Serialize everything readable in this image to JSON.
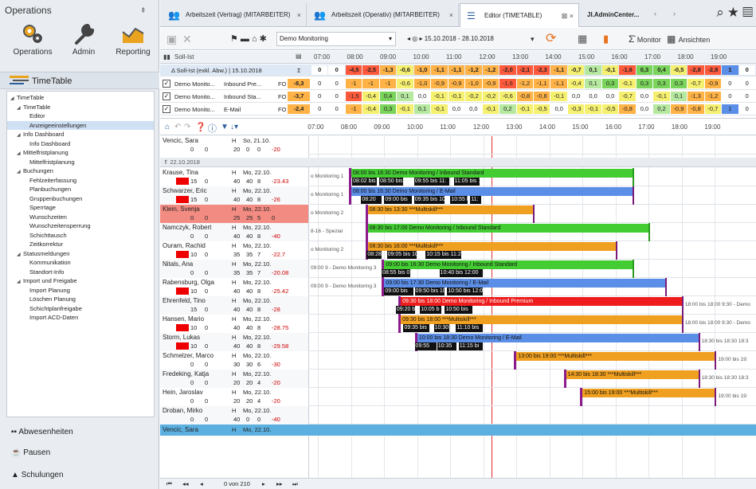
{
  "left": {
    "title": "Operations",
    "pin": "⇞",
    "ribbon": [
      {
        "label": "Operations",
        "icon": "gears-icon"
      },
      {
        "label": "Admin",
        "icon": "wrench-icon"
      },
      {
        "label": "Reporting",
        "icon": "chart-icon"
      }
    ],
    "section_title": "TimeTable",
    "tree": [
      {
        "label": "TimeTable",
        "level": 0,
        "toggle": "◢"
      },
      {
        "label": "TimeTable",
        "level": 1,
        "toggle": "◢"
      },
      {
        "label": "Editor",
        "level": 2
      },
      {
        "label": "Anzeigeeinstellungen",
        "level": 2,
        "selected": true
      },
      {
        "label": "Info Dashboard",
        "level": 1,
        "toggle": "◢"
      },
      {
        "label": "Info Dashboard",
        "level": 2
      },
      {
        "label": "Mittelfristplanung",
        "level": 1,
        "toggle": "◢"
      },
      {
        "label": "Mittelfristplanung",
        "level": 2
      },
      {
        "label": "Buchungen",
        "level": 1,
        "toggle": "◢"
      },
      {
        "label": "Fehlzeiterfassung",
        "level": 2
      },
      {
        "label": "Planbuchungen",
        "level": 2
      },
      {
        "label": "Gruppenbuchungen",
        "level": 2
      },
      {
        "label": "Sperrtage",
        "level": 2
      },
      {
        "label": "Wunschzeiten",
        "level": 2
      },
      {
        "label": "Wunschzeitensperrung",
        "level": 2
      },
      {
        "label": "Schichttausch",
        "level": 2
      },
      {
        "label": "Zeitkorrektur",
        "level": 2
      },
      {
        "label": "Statusmeldungen",
        "level": 1,
        "toggle": "◢"
      },
      {
        "label": "Kommunikation",
        "level": 2
      },
      {
        "label": "Standort-Info",
        "level": 2
      },
      {
        "label": "Import und Freigabe",
        "level": 1,
        "toggle": "◢"
      },
      {
        "label": "Import Planung",
        "level": 2
      },
      {
        "label": "Löschen Planung",
        "level": 2
      },
      {
        "label": "Schichtplanfreigabe",
        "level": 2
      },
      {
        "label": "Import ACD-Daten",
        "level": 2
      }
    ],
    "bottom": [
      {
        "label": "Abwesenheiten",
        "icon": "people-icon"
      },
      {
        "label": "Pausen",
        "icon": "cup-icon"
      },
      {
        "label": "Schulungen",
        "icon": "graduation-cap-icon"
      }
    ]
  },
  "tabs": [
    {
      "label": "Arbeitszeit (Vertrag) (MITARBEITER)",
      "close": "×"
    },
    {
      "label": "Arbeitszeit (Operativ) (MITARBEITER)",
      "close": "×"
    },
    {
      "label": "Editor (TIMETABLE)",
      "close": "⊠ ×",
      "active": true
    },
    {
      "label": "JI.AdminCenter...",
      "close": ""
    }
  ],
  "toolbar": {
    "scenario": "Demo Monitoring",
    "date_range": "15.10.2018 - 28.10.2018",
    "monitor_label": "Monitor",
    "views_label": "Ansichten"
  },
  "soll_ist": {
    "header_label": "Soll-Ist",
    "times": [
      "07:00",
      "08:00",
      "09:00",
      "10:00",
      "11:00",
      "12:00",
      "13:00",
      "14:00",
      "15:00",
      "16:00",
      "17:00",
      "18:00",
      "19:00"
    ],
    "summary_label": "Δ Soll-Ist (exkl. Abw.) | 15.10.2018",
    "summary_sum": "Σ",
    "summary_vals": [
      "0",
      "0",
      "-4,5",
      "-2,5",
      "-1,3",
      "-0,6",
      "-1,0",
      "-1,1",
      "-1,1",
      "-1,2",
      "-1,2",
      "-2,0",
      "-2,1",
      "-2,3",
      "-1,1",
      "-0,7",
      "0,1",
      "-0,1",
      "-1,6",
      "0,3",
      "0,4",
      "-0,5",
      "-2,8",
      "-2,8",
      "1",
      "0"
    ],
    "rows": [
      {
        "a": "Demo Monito...",
        "b": "Inbound Pre...",
        "c": "FO",
        "sum": "-8,3",
        "vals": [
          "0",
          "0",
          "-1",
          "-1",
          "-1",
          "-0,6",
          "-1,0",
          "-0,9",
          "-0,9",
          "-1,0",
          "-0,9",
          "-1,6",
          "-1,2",
          "-1,1",
          "-1,1",
          "-0,4",
          "0,1",
          "0,3",
          "-0,1",
          "0,3",
          "0,3",
          "0,3",
          "-0,7",
          "-0,9",
          "0",
          "0"
        ]
      },
      {
        "a": "Demo Monito...",
        "b": "Inbound Sta...",
        "c": "FO",
        "sum": "-3,7",
        "vals": [
          "0",
          "0",
          "-1,5",
          "-0,4",
          "0,4",
          "0,1",
          "0,0",
          "-0,1",
          "-0,1",
          "-0,2",
          "-0,2",
          "-0,6",
          "-0,8",
          "-0,8",
          "-0,1",
          "0,0",
          "0,0",
          "0,0",
          "-0,7",
          "0,0",
          "-0,1",
          "0,1",
          "-1,3",
          "-1,2",
          "0",
          "0"
        ]
      },
      {
        "a": "Demo Monito...",
        "b": "E-Mail",
        "c": "FO",
        "sum": "-2,4",
        "vals": [
          "0",
          "0",
          "-1",
          "-0,4",
          "0,3",
          "-0,1",
          "0,1",
          "-0,1",
          "0,0",
          "0,0",
          "-0,1",
          "0,2",
          "-0,1",
          "-0,5",
          "0,0",
          "-0,3",
          "-0,1",
          "-0,5",
          "-0,8",
          "0,0",
          "0,2",
          "-0,9",
          "-0,8",
          "-0,7",
          "1",
          "0"
        ]
      }
    ]
  },
  "timeline": {
    "times": [
      "07:00",
      "08:00",
      "09:00",
      "10:00",
      "11:00",
      "12:00",
      "13:00",
      "14:00",
      "15:00",
      "16:00",
      "17:00",
      "18:00",
      "19:00"
    ],
    "date_header": "22.10.2018",
    "employees": [
      {
        "name": "Vencic, Sara",
        "type": "H",
        "day": "So, 21.10.",
        "v1": "0",
        "v2": "0",
        "v3": "20",
        "v4": "0",
        "v5": "0",
        "v6": "-20",
        "v6neg": true
      },
      {
        "name": "Krause, Tina",
        "type": "H",
        "day": "Mo, 22.10.",
        "v1": "15",
        "v2": "0",
        "v3": "40",
        "v4": "40",
        "v5": "8",
        "v6": "-23.43",
        "v6neg": true,
        "red": true,
        "sub": "o Monitoring 1",
        "bar": {
          "label": "08:00 bis 16:30 Demo Monitoring / Inbound Standard",
          "start": 8.0,
          "end": 16.5,
          "color": "#44cc33"
        },
        "blocks": [
          {
            "label": "08:02 bis 08:",
            "s": 8.03,
            "e": 8.8
          },
          {
            "label": "08:50 bis 09:",
            "s": 8.85,
            "e": 9.6
          },
          {
            "label": "09:55 bis 11:",
            "s": 9.9,
            "e": 11.0
          },
          {
            "label": "11:05 bis 1",
            "s": 11.1,
            "e": 11.9
          }
        ]
      },
      {
        "name": "Schwarzer, Eric",
        "type": "H",
        "day": "Mo, 22.10.",
        "v1": "15",
        "v2": "0",
        "v3": "40",
        "v4": "40",
        "v5": "8",
        "v6": "-26",
        "v6neg": true,
        "red": true,
        "sub": "o Monitoring 1",
        "bar": {
          "label": "08:00 bis 16:30 Demo Monitoring / E-Mail",
          "start": 8.0,
          "end": 16.5,
          "color": "#5b8ee6"
        },
        "blocks": [
          {
            "label": "08:20",
            "s": 8.3,
            "e": 8.95
          },
          {
            "label": "09:00 bis",
            "s": 9.0,
            "e": 9.85
          },
          {
            "label": "09:35 bis 10",
            "s": 9.9,
            "e": 10.85
          },
          {
            "label": "10:55 b",
            "s": 11.0,
            "e": 11.55
          },
          {
            "label": "11:",
            "s": 11.6,
            "e": 11.95
          }
        ]
      },
      {
        "name": "Klein, Svenja",
        "type": "H",
        "day": "Mo, 22.10.",
        "v1": "0",
        "v2": "0",
        "v3": "25",
        "v4": "25",
        "v5": "5",
        "v6": "0",
        "v6neg": false,
        "highlight": true,
        "sub": "o Monitoring 2",
        "bar": {
          "label": "08:30 bis 13:30 ***Multiskill***",
          "start": 8.5,
          "end": 13.5,
          "color": "#f0a020"
        },
        "blocks": []
      },
      {
        "name": "Namczyk, Robert",
        "type": "H",
        "day": "Mo, 22.10.",
        "v1": "0",
        "v2": "0",
        "v3": "40",
        "v4": "40",
        "v5": "8",
        "v6": "-40",
        "v6neg": true,
        "sub": "8-16 - Spezial",
        "bar": {
          "label": "08:30 bis 17:00 Demo Monitoring / Inbound Standard",
          "start": 8.5,
          "end": 17.0,
          "color": "#44cc33"
        },
        "blocks": []
      },
      {
        "name": "Ouram, Rachid",
        "type": "H",
        "day": "Mo, 22.10.",
        "v1": "10",
        "v2": "0",
        "v3": "35",
        "v4": "35",
        "v5": "7",
        "v6": "-22.7",
        "v6neg": true,
        "red": true,
        "sub": "o Monitoring 2",
        "bar": {
          "label": "08:30 bis 16:00 ***Multiskill***",
          "start": 8.5,
          "end": 16.0,
          "color": "#f0a020"
        },
        "blocks": [
          {
            "label": "08:28",
            "s": 8.47,
            "e": 8.95
          },
          {
            "label": "09:05 bis 10",
            "s": 9.08,
            "e": 10.0
          },
          {
            "label": "10:15 bis 11:2",
            "s": 10.25,
            "e": 11.35
          }
        ]
      },
      {
        "name": "Nitals, Ana",
        "type": "H",
        "day": "Mo, 22.10.",
        "v1": "0",
        "v2": "0",
        "v3": "35",
        "v4": "35",
        "v5": "7",
        "v6": "-20.08",
        "v6neg": true,
        "sub": "09:00 9 - Demo Monitoring 3",
        "bar": {
          "label": "09:00 bis 16:30 Demo Monitoring / Inbound Standard",
          "start": 9.0,
          "end": 16.5,
          "color": "#44cc33"
        },
        "blocks": [
          {
            "label": "08:55 bis 0",
            "s": 8.92,
            "e": 9.8
          },
          {
            "label": "10:40 bis 12:00",
            "s": 10.67,
            "e": 12.0
          }
        ]
      },
      {
        "name": "Rabensburg, Olga",
        "type": "H",
        "day": "Mo, 22.10.",
        "v1": "10",
        "v2": "0",
        "v3": "40",
        "v4": "40",
        "v5": "8",
        "v6": "-25.42",
        "v6neg": true,
        "red": true,
        "sub": "09:00 9 - Demo Monitoring 3",
        "bar": {
          "label": "09:00 bis 17:30 Demo Monitoring / E-Mail",
          "start": 9.0,
          "end": 17.5,
          "color": "#5b8ee6"
        },
        "blocks": [
          {
            "label": "09:00 bis",
            "s": 9.0,
            "e": 9.9
          },
          {
            "label": "09:50 bis 10:",
            "s": 9.92,
            "e": 10.85
          },
          {
            "label": "10:50 bis 12:0",
            "s": 10.9,
            "e": 12.0
          }
        ]
      },
      {
        "name": "Ehrenfeld, Tino",
        "type": "H",
        "day": "Mo, 22.10.",
        "v1": "15",
        "v2": "0",
        "v3": "40",
        "v4": "40",
        "v5": "8",
        "v6": "-28",
        "v6neg": true,
        "sub": "",
        "bar": {
          "label": "09:30 bis 18:00 Demo Monitoring / Inbound Premium",
          "start": 9.5,
          "end": 18.0,
          "color": "#ee1c1c"
        },
        "blocks": [
          {
            "label": "09:20 b",
            "s": 9.35,
            "e": 9.95
          },
          {
            "label": "10:05 b",
            "s": 10.08,
            "e": 10.75
          },
          {
            "label": "10:50 bis",
            "s": 10.83,
            "e": 11.7
          }
        ],
        "after": "18:00 bis 18:00 9:30 - Demo"
      },
      {
        "name": "Hansen, Mario",
        "type": "H",
        "day": "Mo, 22.10.",
        "v1": "10",
        "v2": "0",
        "v3": "40",
        "v4": "40",
        "v5": "8",
        "v6": "-28.75",
        "v6neg": true,
        "red": true,
        "sub": "",
        "bar": {
          "label": "09:30 bis 18:00 ***Multiskill***",
          "start": 9.5,
          "end": 18.0,
          "color": "#f0a020"
        },
        "blocks": [
          {
            "label": "09:35 bis",
            "s": 9.58,
            "e": 10.4
          },
          {
            "label": "10:30",
            "s": 10.5,
            "e": 11.0
          },
          {
            "label": "11:10 bis",
            "s": 11.17,
            "e": 12.0
          }
        ],
        "after": "18:00 bis 18:00 9:30 - Demo"
      },
      {
        "name": "Storm, Lukas",
        "type": "H",
        "day": "Mo, 22.10.",
        "v1": "10",
        "v2": "0",
        "v3": "40",
        "v4": "40",
        "v5": "8",
        "v6": "-29.58",
        "v6neg": true,
        "red": true,
        "sub": "",
        "bar": {
          "label": "10:00 bis 18:30 Demo Monitoring / E-Mail",
          "start": 10.0,
          "end": 18.5,
          "color": "#5b8ee6"
        },
        "blocks": [
          {
            "label": "09:55",
            "s": 9.92,
            "e": 10.6
          },
          {
            "label": "10:35",
            "s": 10.6,
            "e": 11.2
          },
          {
            "label": "11:15 bi",
            "s": 11.25,
            "e": 12.0
          }
        ],
        "after": "18:30 bis 18:30 18:3"
      },
      {
        "name": "Schmelzer, Marco",
        "type": "H",
        "day": "Mo, 22.10.",
        "v1": "0",
        "v2": "0",
        "v3": "30",
        "v4": "30",
        "v5": "6",
        "v6": "-30",
        "v6neg": true,
        "sub": "",
        "bar": {
          "label": "13:00 bis 19:00 ***Multiskill***",
          "start": 13.0,
          "end": 19.0,
          "color": "#f0a020"
        },
        "blocks": [],
        "after": "19:00 bis 19:"
      },
      {
        "name": "Fredeking, Katja",
        "type": "H",
        "day": "Mo, 22.10.",
        "v1": "0",
        "v2": "0",
        "v3": "20",
        "v4": "20",
        "v5": "4",
        "v6": "-20",
        "v6neg": true,
        "sub": "",
        "bar": {
          "label": "14:30 bis 18:30 ***Multiskill***",
          "start": 14.5,
          "end": 18.5,
          "color": "#f0a020"
        },
        "blocks": [],
        "after": "18:30 bis 18:30 18:3"
      },
      {
        "name": "Hein, Jaroslav",
        "type": "H",
        "day": "Mo, 22.10.",
        "v1": "0",
        "v2": "0",
        "v3": "20",
        "v4": "20",
        "v5": "4",
        "v6": "-20",
        "v6neg": true,
        "sub": "",
        "bar": {
          "label": "15:00 bis 19:00 ***Multiskill***",
          "start": 15.0,
          "end": 19.0,
          "color": "#f0a020"
        },
        "blocks": [],
        "after": "19:00 bis 19:"
      },
      {
        "name": "Droban, Mirko",
        "type": "H",
        "day": "Mo, 22.10.",
        "v1": "0",
        "v2": "0",
        "v3": "40",
        "v4": "0",
        "v5": "0",
        "v6": "-40",
        "v6neg": true
      }
    ],
    "footer_employee": {
      "name": "Vencic, Sara",
      "type": "H",
      "day": "Mo, 22.10."
    }
  },
  "status": {
    "pager": "0 von 210",
    "first": "⏮",
    "prev_page": "◂◂",
    "prev": "◂",
    "next": "▸",
    "next_page": "▸▸",
    "last": "⏭"
  },
  "colors": {
    "green": "#44cc33",
    "blue": "#5b8ee6",
    "orange": "#f0a020",
    "red": "#ee1c1c",
    "now_line": "#e03030"
  }
}
